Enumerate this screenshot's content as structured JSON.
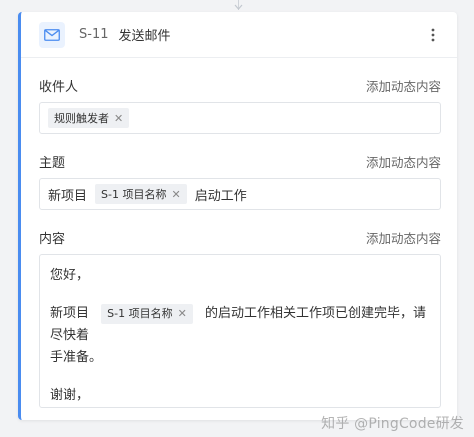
{
  "step": {
    "code": "S-11",
    "title": "发送邮件",
    "more_icon": "vertical-ellipsis-icon",
    "type_icon": "mail-icon"
  },
  "recipient": {
    "label": "收件人",
    "add_dynamic": "添加动态内容",
    "tags": [
      "规则触发者"
    ]
  },
  "subject": {
    "label": "主题",
    "add_dynamic": "添加动态内容",
    "prefix": "新项目",
    "tag": "S-1 项目名称",
    "suffix": "启动工作"
  },
  "body": {
    "label": "内容",
    "add_dynamic": "添加动态内容",
    "greeting": "您好，",
    "line_prefix": "新项目",
    "tag": "S-1 项目名称",
    "line_suffix_1": "的启动工作相关工作项已创建完毕，请尽快着",
    "line_suffix_2": "手准备。",
    "closing": "谢谢，"
  },
  "watermark": "知乎 @PingCode研发",
  "colors": {
    "accent": "#4a8cf0",
    "tag_bg": "#eef0f3",
    "border": "#e1e4e8"
  }
}
